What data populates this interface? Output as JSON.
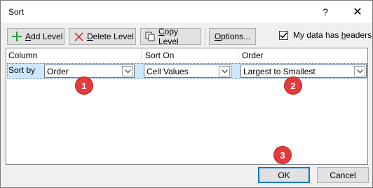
{
  "window": {
    "title": "Sort",
    "help_label": "?",
    "close_label": "✕"
  },
  "toolbar": {
    "add_level": {
      "prefix": "",
      "accel": "A",
      "suffix": "dd Level"
    },
    "delete_level": {
      "prefix": "",
      "accel": "D",
      "suffix": "elete Level"
    },
    "copy_level": {
      "prefix": "",
      "accel": "C",
      "suffix": "opy Level"
    },
    "options": {
      "prefix": "",
      "accel": "O",
      "suffix": "ptions..."
    },
    "headers_checkbox": {
      "label_prefix": "My data has ",
      "accel": "h",
      "label_suffix": "eaders",
      "checked": true
    }
  },
  "grid": {
    "headers": {
      "column": "Column",
      "sort_on": "Sort On",
      "order": "Order"
    },
    "rows": [
      {
        "label": "Sort by",
        "column": "Order",
        "sort_on": "Cell Values",
        "order": "Largest to Smallest"
      }
    ]
  },
  "annotations": {
    "badge1": "1",
    "badge2": "2",
    "badge3": "3",
    "color": "#e23b3b"
  },
  "footer": {
    "ok": "OK",
    "cancel": "Cancel"
  }
}
